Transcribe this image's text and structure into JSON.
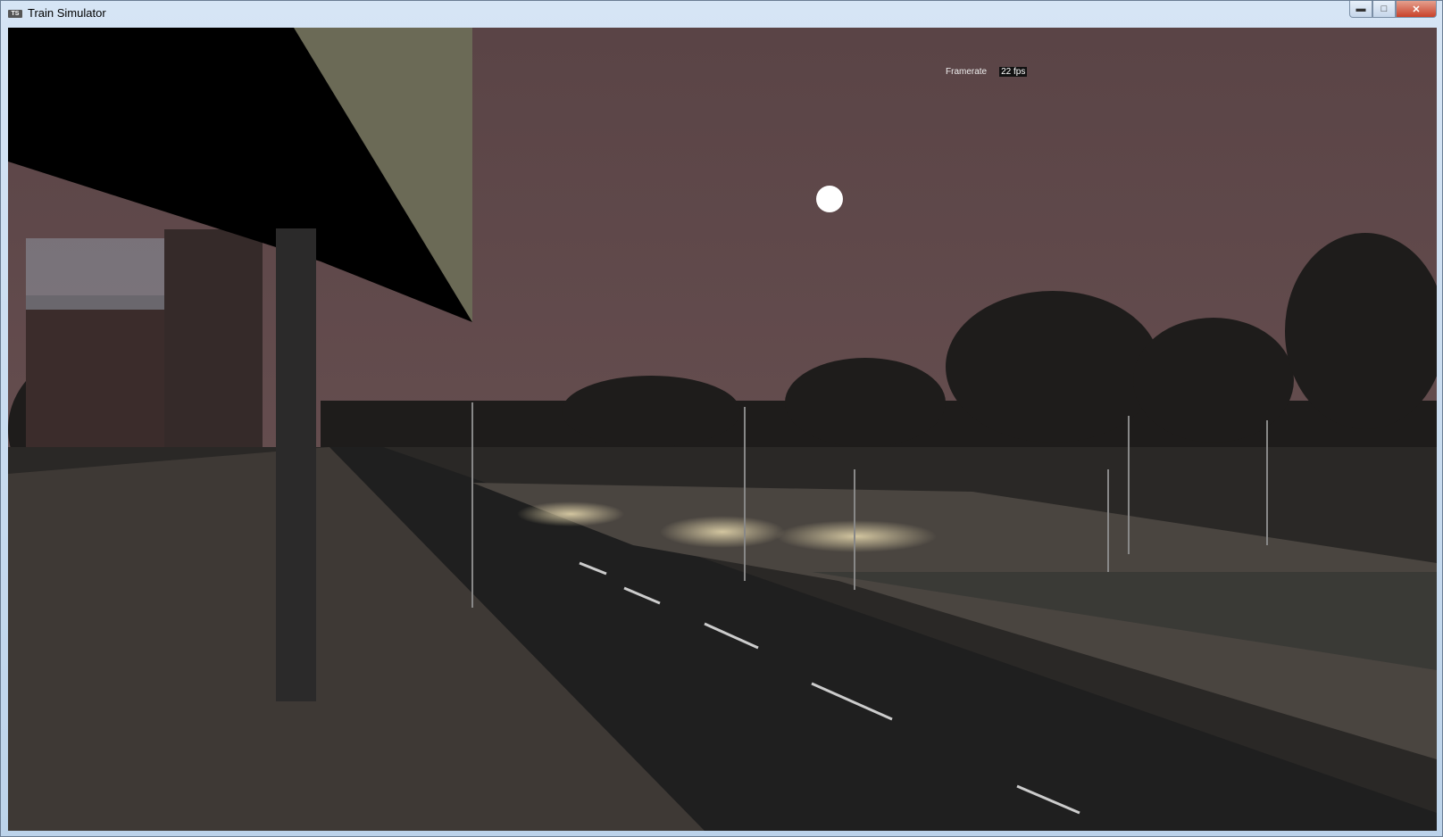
{
  "window": {
    "title": "Train Simulator",
    "icon": "TS",
    "minimize_icon": "minimize-icon",
    "maximize_icon": "maximize-icon",
    "close_icon": "close-icon"
  },
  "hud": {
    "framerate_label": "Framerate",
    "framerate_value": "22 fps"
  }
}
